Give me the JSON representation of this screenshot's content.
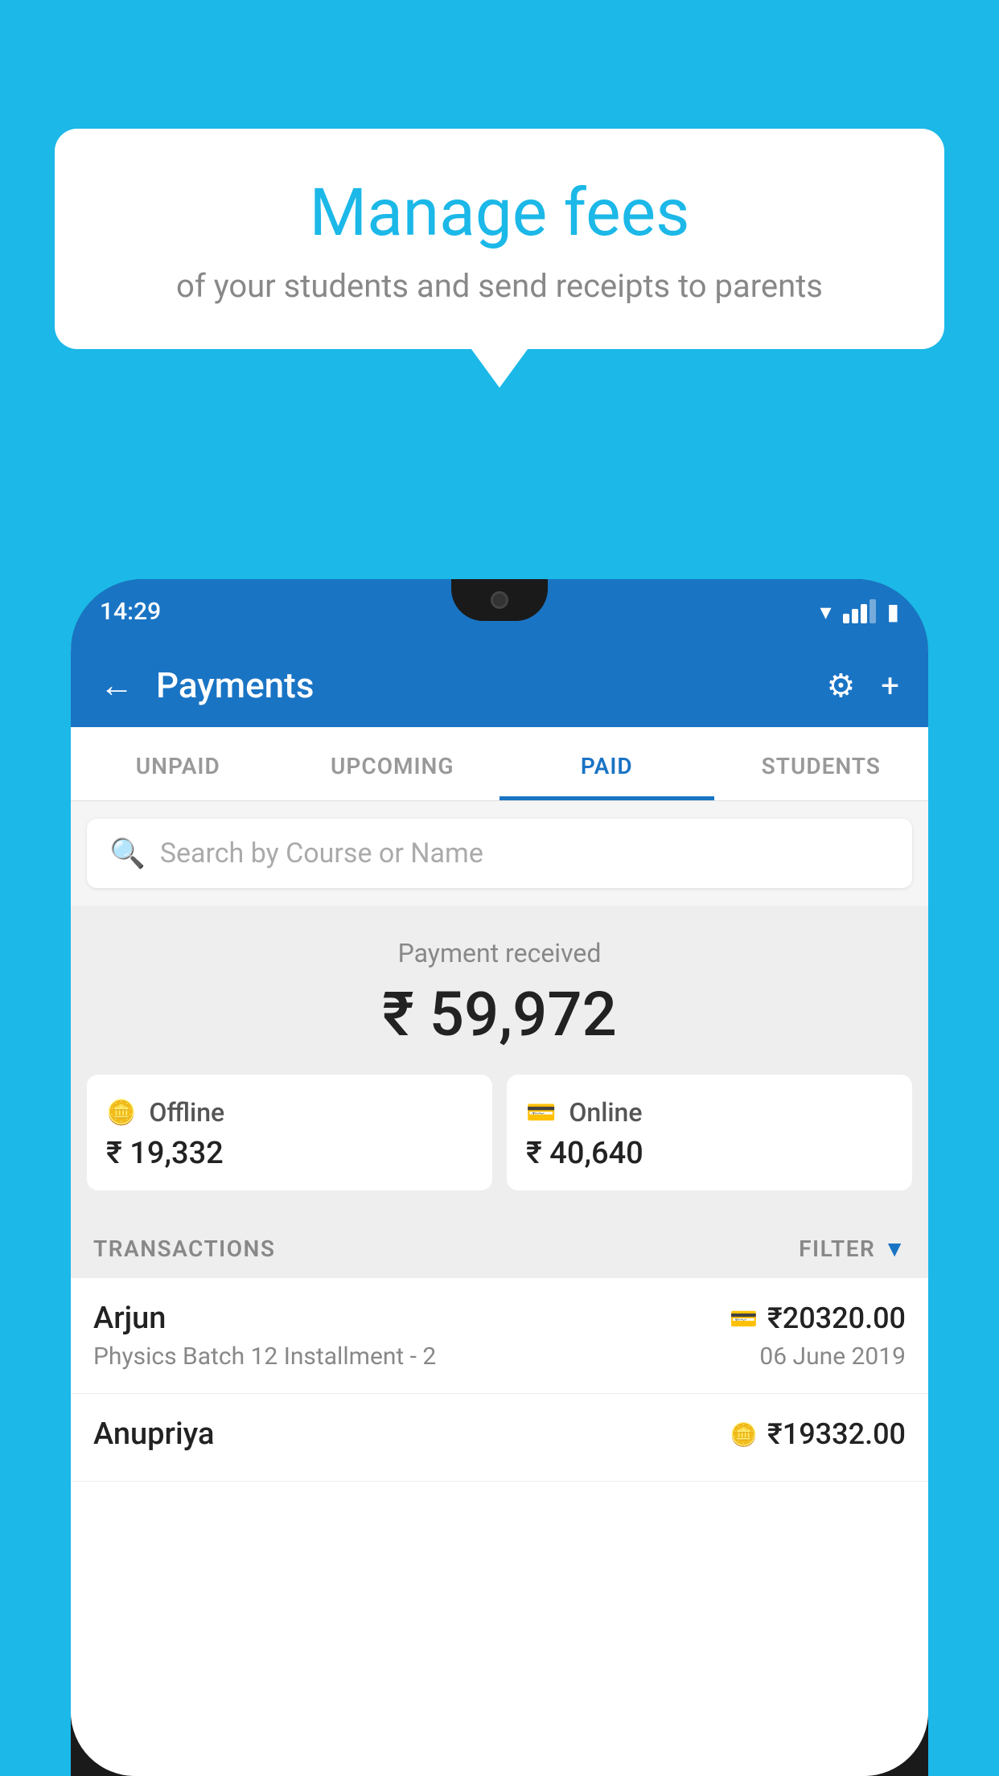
{
  "background_color": "#1bb8e8",
  "bubble": {
    "title": "Manage fees",
    "subtitle": "of your students and send receipts to parents"
  },
  "status_bar": {
    "time": "14:29"
  },
  "app_bar": {
    "title": "Payments",
    "back_label": "←",
    "settings_label": "⚙",
    "add_label": "+"
  },
  "tabs": [
    {
      "label": "UNPAID",
      "active": false
    },
    {
      "label": "UPCOMING",
      "active": false
    },
    {
      "label": "PAID",
      "active": true
    },
    {
      "label": "STUDENTS",
      "active": false
    }
  ],
  "search": {
    "placeholder": "Search by Course or Name"
  },
  "payment": {
    "label": "Payment received",
    "amount": "₹ 59,972",
    "offline": {
      "type": "Offline",
      "amount": "₹ 19,332"
    },
    "online": {
      "type": "Online",
      "amount": "₹ 40,640"
    }
  },
  "transactions_label": "TRANSACTIONS",
  "filter_label": "FILTER",
  "transactions": [
    {
      "name": "Arjun",
      "amount": "₹20320.00",
      "mode": "card",
      "course": "Physics Batch 12 Installment - 2",
      "date": "06 June 2019"
    },
    {
      "name": "Anupriya",
      "amount": "₹19332.00",
      "mode": "cash",
      "course": "",
      "date": ""
    }
  ]
}
